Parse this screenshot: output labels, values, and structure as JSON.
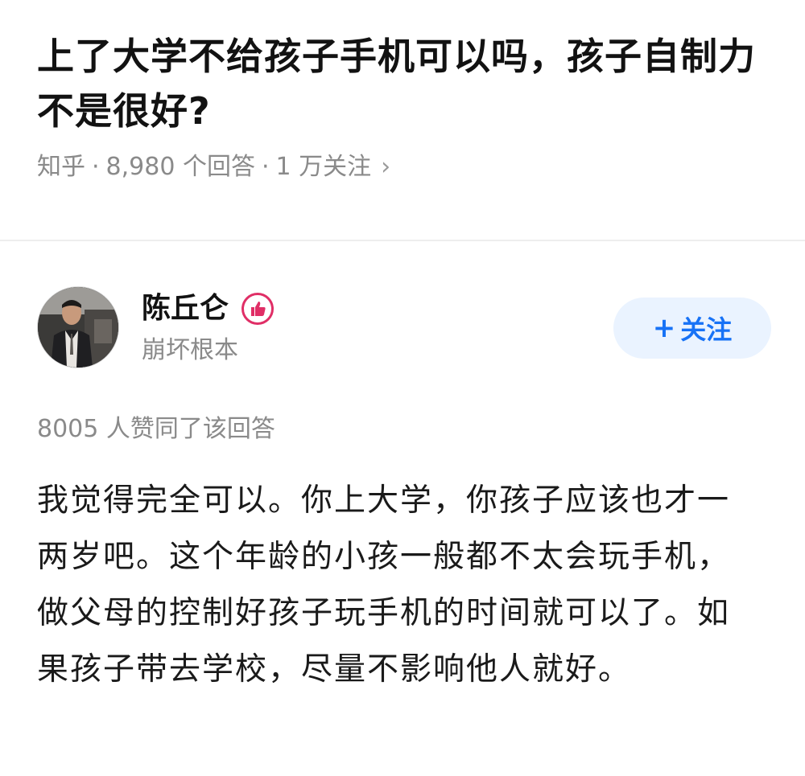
{
  "question": {
    "title": "上了大学不给孩子手机可以吗，孩子自制力不是很好?",
    "source": "知乎",
    "separator": "·",
    "answer_count": "8,980 个回答",
    "follow_count": "1 万关注",
    "chevron": "›"
  },
  "author": {
    "name": "陈丘仑",
    "description": "崩坏根本",
    "badge_icon": "thumbs-up-icon",
    "follow_plus": "+",
    "follow_label": "关注"
  },
  "answer": {
    "votes": "8005 人赞同了该回答",
    "text": "我觉得完全可以。你上大学，你孩子应该也才一两岁吧。这个年龄的小孩一般都不太会玩手机，做父母的控制好孩子玩手机的时间就可以了。如果孩子带去学校，尽量不影响他人就好。"
  },
  "colors": {
    "accent": "#1772f6",
    "follow_bg": "#eaf3ff",
    "badge": "#e02e66",
    "meta_text": "#8a8a8a"
  }
}
